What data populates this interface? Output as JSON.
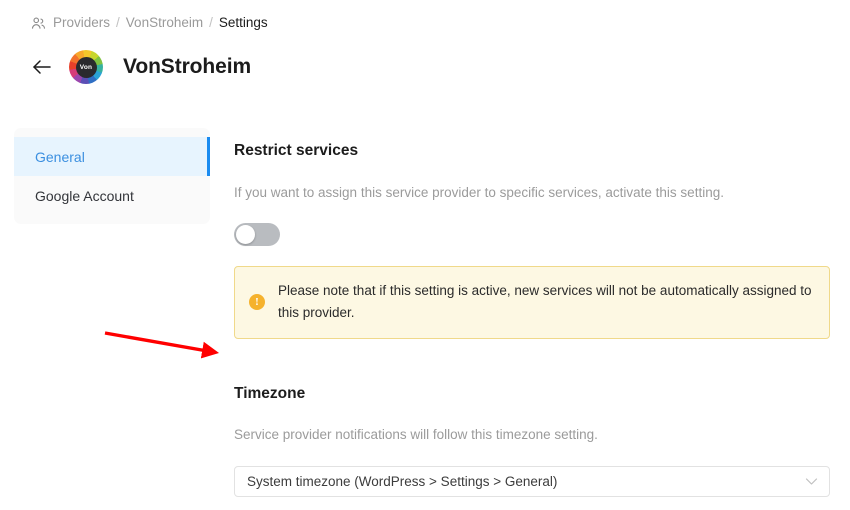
{
  "breadcrumb": {
    "icon": "people-icon",
    "items": [
      "Providers",
      "VonStroheim",
      "Settings"
    ],
    "separator": "/"
  },
  "header": {
    "back_icon": "arrow-left-icon",
    "avatar_text": "Von",
    "title": "VonStroheim"
  },
  "sidebar": {
    "items": [
      {
        "label": "General",
        "active": true
      },
      {
        "label": "Google Account",
        "active": false
      }
    ]
  },
  "main": {
    "restrict": {
      "title": "Restrict services",
      "description": "If you want to assign this service provider to specific services, activate this setting.",
      "toggle_on": false,
      "notice": {
        "icon": "warning-exclamation-icon",
        "text": "Please note that if this setting is active, new services will not be automatically assigned to this provider."
      }
    },
    "timezone": {
      "title": "Timezone",
      "description": "Service provider notifications will follow this timezone setting.",
      "select_value": "System timezone (WordPress > Settings > General)",
      "chevron_icon": "chevron-down-icon"
    }
  },
  "annotation": {
    "type": "red-arrow",
    "color": "#ff0000",
    "points_to": "Timezone"
  },
  "colors": {
    "accent": "#1a8bf0",
    "active_text": "#3b8fe0",
    "active_bg": "#e7f4fe",
    "sidebar_bg": "#fafafa",
    "notice_bg": "#fdf8e3",
    "notice_border": "#f0d98a",
    "notice_icon": "#f5b22d",
    "muted_text": "#9b9b9b",
    "annotation": "#ff0000"
  }
}
